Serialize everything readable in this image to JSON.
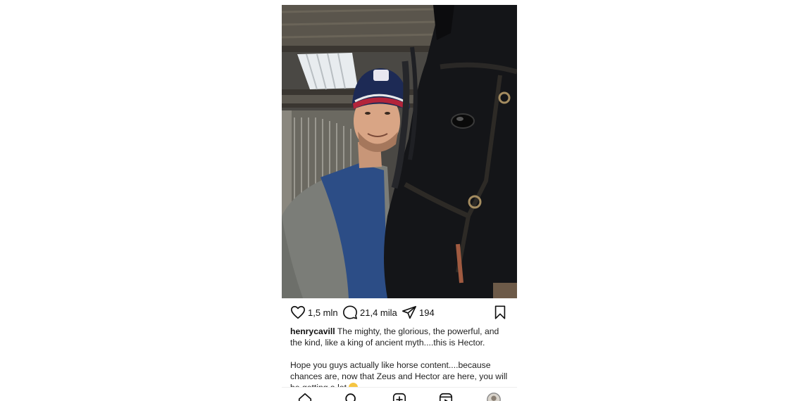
{
  "post": {
    "likes": "1,5 mln",
    "comments": "21,4 mila",
    "shares": "194",
    "username": "henrycavill",
    "caption_line1": "The mighty, the glorious, the powerful, and the kind, like a king of ancient myth....this is Hector.",
    "caption_line2": "Hope you guys actually like horse content....because chances are, now that Zeus and Hector are here, you will be getting a lot"
  },
  "icons": {
    "like": "heart-icon",
    "comment": "comment-icon",
    "share": "send-icon",
    "save": "bookmark-icon",
    "nav": [
      "home-icon",
      "search-icon",
      "add-post-icon",
      "reels-icon",
      "profile-avatar"
    ]
  },
  "colors": {
    "text": "#111111",
    "background": "#ffffff"
  }
}
